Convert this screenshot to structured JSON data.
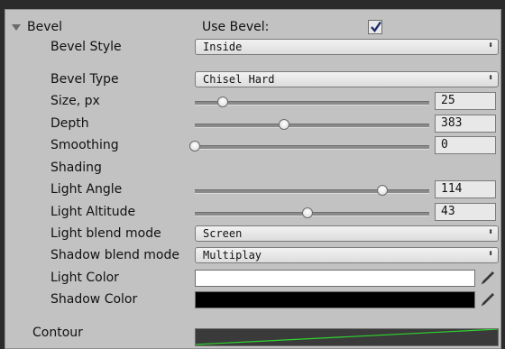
{
  "bevel": {
    "section_title": "Bevel",
    "use_bevel_label": "Use Bevel:",
    "use_bevel_checked": true,
    "bevel_style": {
      "label": "Bevel Style",
      "value": "Inside"
    },
    "bevel_type": {
      "label": "Bevel Type",
      "value": "Chisel Hard"
    },
    "size": {
      "label": "Size, px",
      "value": "25",
      "fraction": 0.12
    },
    "depth": {
      "label": "Depth",
      "value": "383",
      "fraction": 0.38
    },
    "smoothing": {
      "label": "Smoothing",
      "value": "0",
      "fraction": 0.0
    },
    "shading_label": "Shading",
    "light_angle": {
      "label": "Light Angle",
      "value": "114",
      "fraction": 0.8
    },
    "light_altitude": {
      "label": "Light Altitude",
      "value": "43",
      "fraction": 0.48
    },
    "light_blend_mode": {
      "label": "Light blend mode",
      "value": "Screen"
    },
    "shadow_blend_mode": {
      "label": "Shadow blend mode",
      "value": "Multiplay"
    },
    "light_color": {
      "label": "Light Color",
      "color": "#ffffff"
    },
    "shadow_color": {
      "label": "Shadow Color",
      "color": "#000000"
    },
    "contour_label": "Contour",
    "contour_line_color": "#2fd52f"
  },
  "colors": {
    "panel_bg": "#c2c2c2",
    "outer_bg": "#2b2b2b",
    "checkbox_check": "#1f2d6b"
  }
}
